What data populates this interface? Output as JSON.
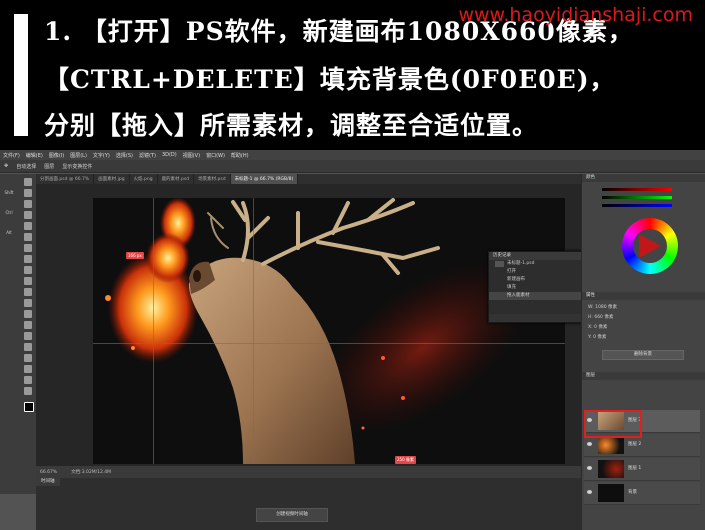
{
  "caption": {
    "line1": "1. 【打开】PS软件，新建画布1080X660像素，",
    "line2": "【CTRL+DELETE】填充背景色(0F0E0E)，",
    "line3": "分别【拖入】所需素材，调整至合适位置。",
    "watermark": "www.haoyidianshaji.com"
  },
  "menu": [
    "文件(F)",
    "编辑(E)",
    "图像(I)",
    "图层(L)",
    "文字(Y)",
    "选择(S)",
    "滤镜(T)",
    "3D(D)",
    "视图(V)",
    "窗口(W)",
    "帮助(H)"
  ],
  "options": [
    "自动选择",
    "图层",
    "显示变换控件"
  ],
  "tabs": [
    "分割画面.psd @ 66.7%",
    "画面素材.jpg",
    "火焰.png",
    "鹿的素材.psd",
    "场景素材.psd",
    "未标题-1 @ 66.7% (RGB/8)"
  ],
  "tools_side": [
    "Shift",
    "Ctrl",
    "Alt"
  ],
  "canvas": {
    "bg_color": "#0f0e0e",
    "tag_left": "166 px",
    "tag_bottom": "250 像素"
  },
  "history": {
    "title": "历史记录",
    "file": "未标题-1.psd",
    "items": [
      "打开",
      "新建画布",
      "填充",
      "拖入鹿素材"
    ]
  },
  "status": {
    "zoom": "66.67%",
    "doc": "文档:3.02M/12.4M"
  },
  "timeline": {
    "tab": "时间轴",
    "button": "创建视频时间轴"
  },
  "panels": {
    "color_title": "颜色",
    "props_title": "属性",
    "props_rows": [
      "W: 1080 像素",
      "H: 660 像素",
      "X: 0 像素",
      "Y: 0 像素"
    ],
    "props_button": "删除背景",
    "layers_title": "图层",
    "layers": [
      {
        "name": "图层 3",
        "selected": true
      },
      {
        "name": "图层 2",
        "selected": false
      },
      {
        "name": "图层 1",
        "selected": false
      },
      {
        "name": "背景",
        "selected": false
      }
    ]
  }
}
